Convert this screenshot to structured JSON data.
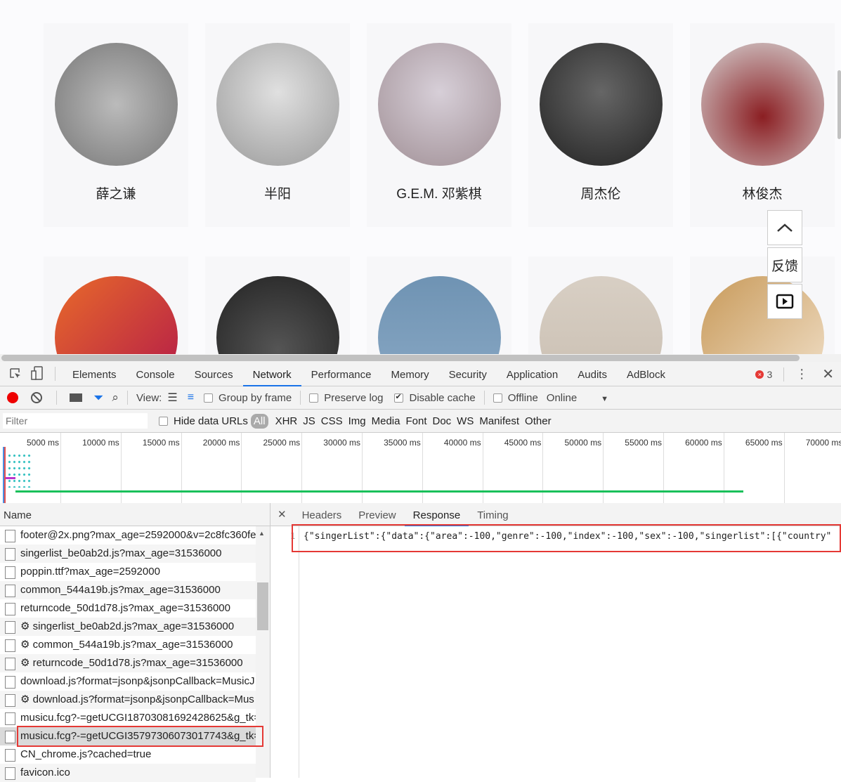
{
  "singers_row1": [
    {
      "name": "薛之谦",
      "bg": "radial-gradient(circle at 50% 50%,#bbb,#777)"
    },
    {
      "name": "半阳",
      "bg": "radial-gradient(circle at 50% 40%,#e0e0e0,#9a9a9a)"
    },
    {
      "name": "G.E.M. 邓紫棋",
      "bg": "radial-gradient(circle at 50% 40%,#d7cfd8,#a08f95)"
    },
    {
      "name": "周杰伦",
      "bg": "radial-gradient(circle at 50% 40%,#666,#222)"
    },
    {
      "name": "林俊杰",
      "bg": "radial-gradient(circle at 50% 60%,#8b1e22,#d8d8d8)"
    }
  ],
  "singers_row2": [
    {
      "bg": "linear-gradient(135deg,#e86a2a,#b2184a)"
    },
    {
      "bg": "radial-gradient(circle at 50% 60%,#555,#222)"
    },
    {
      "bg": "linear-gradient(180deg,#6f93b3,#8aa9c5)"
    },
    {
      "bg": "linear-gradient(180deg,#d8cfc4,#c9beb1)"
    },
    {
      "bg": "linear-gradient(135deg,#c89a5a,#f2e2cc)"
    }
  ],
  "side_buttons": {
    "top_icon": "chevron-up-icon",
    "feedback": "反馈",
    "player_icon": "play-icon"
  },
  "devtools": {
    "tabs": [
      "Elements",
      "Console",
      "Sources",
      "Network",
      "Performance",
      "Memory",
      "Security",
      "Application",
      "Audits",
      "AdBlock"
    ],
    "active_tab": "Network",
    "error_count": "3",
    "toolbar": {
      "view_label": "View:",
      "group_by_frame": "Group by frame",
      "preserve_log": "Preserve log",
      "disable_cache": "Disable cache",
      "offline": "Offline",
      "throttle": "Online"
    },
    "filter": {
      "placeholder": "Filter",
      "hide_data_urls": "Hide data URLs",
      "types": [
        "All",
        "XHR",
        "JS",
        "CSS",
        "Img",
        "Media",
        "Font",
        "Doc",
        "WS",
        "Manifest",
        "Other"
      ]
    },
    "timeline_ticks": [
      "5000 ms",
      "10000 ms",
      "15000 ms",
      "20000 ms",
      "25000 ms",
      "30000 ms",
      "35000 ms",
      "40000 ms",
      "45000 ms",
      "50000 ms",
      "55000 ms",
      "60000 ms",
      "65000 ms",
      "70000 ms"
    ],
    "name_header": "Name",
    "requests": [
      "footer@2x.png?max_age=2592000&v=2c8fc360fe...",
      "singerlist_be0ab2d.js?max_age=31536000",
      "poppin.ttf?max_age=2592000",
      "common_544a19b.js?max_age=31536000",
      "returncode_50d1d78.js?max_age=31536000",
      "⚙ singerlist_be0ab2d.js?max_age=31536000",
      "⚙ common_544a19b.js?max_age=31536000",
      "⚙ returncode_50d1d78.js?max_age=31536000",
      "download.js?format=jsonp&jsonpCallback=MusicJ",
      "⚙ download.js?format=jsonp&jsonpCallback=Mus",
      "musicu.fcg?-=getUCGI18703081692428625&g_tk=",
      "musicu.fcg?-=getUCGI35797306073017743&g_tk=",
      "CN_chrome.js?cached=true",
      "favicon.ico"
    ],
    "selected_request": 11,
    "detail_tabs": [
      "Headers",
      "Preview",
      "Response",
      "Timing"
    ],
    "active_detail_tab": "Response",
    "response_line_no": "1",
    "response_text": "{\"singerList\":{\"data\":{\"area\":-100,\"genre\":-100,\"index\":-100,\"sex\":-100,\"singerlist\":[{\"country\""
  }
}
